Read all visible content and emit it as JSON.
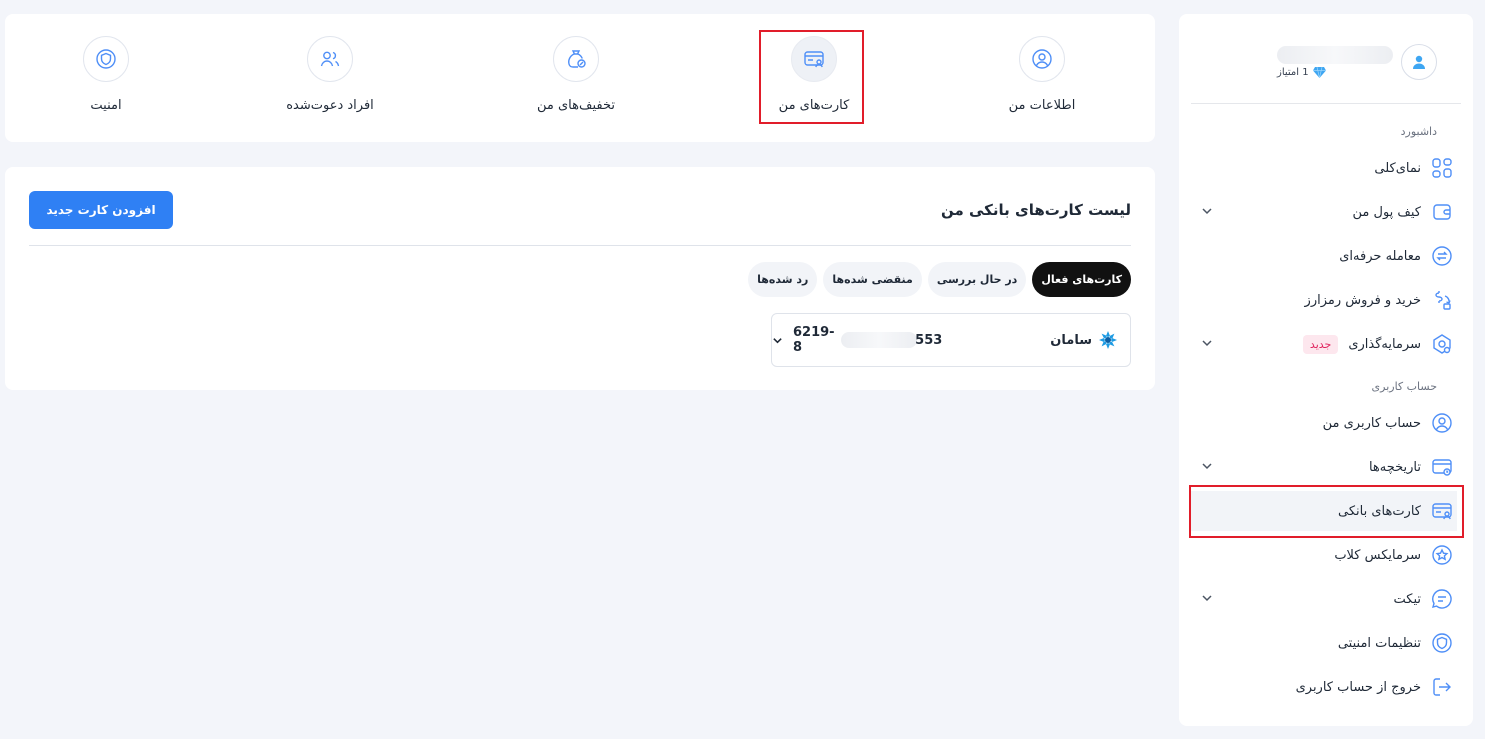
{
  "sidebar": {
    "user": {
      "points": "1 امتیاز"
    },
    "sections": {
      "dashboard": "داشبورد",
      "account": "حساب کاربری"
    },
    "items": [
      {
        "label": "نمای‌کلی"
      },
      {
        "label": "کیف پول من"
      },
      {
        "label": "معامله حرفه‌ای"
      },
      {
        "label": "خرید و فروش رمزارز"
      },
      {
        "label": "سرمایه‌گذاری",
        "badge": "جدید"
      },
      {
        "label": "حساب کاربری من"
      },
      {
        "label": "تاریخچه‌ها"
      },
      {
        "label": "کارت‌های بانکی"
      },
      {
        "label": "سرمایکس کلاب"
      },
      {
        "label": "تیکت"
      },
      {
        "label": "تنظیمات امنیتی"
      },
      {
        "label": "خروج از حساب کاربری"
      }
    ]
  },
  "top_tabs": [
    {
      "label": "اطلاعات من"
    },
    {
      "label": "کارت‌های من"
    },
    {
      "label": "تخفیف‌های من"
    },
    {
      "label": "افراد دعوت‌شده"
    },
    {
      "label": "امنیت"
    }
  ],
  "cards": {
    "title": "لیست کارت‌های بانکی من",
    "add_button": "افزودن کارت جدید",
    "filters": [
      {
        "label": "کارت‌های فعال"
      },
      {
        "label": "در حال بررسی"
      },
      {
        "label": "منقضی شده‌ها"
      },
      {
        "label": "رد شده‌ها"
      }
    ],
    "bank_card": {
      "bank_name": "سامان",
      "number_start": "6219-8",
      "number_end": "553"
    }
  },
  "colors": {
    "accent": "#2f80f4",
    "highlight": "#e11d2a",
    "badge_text": "#e0245e"
  }
}
